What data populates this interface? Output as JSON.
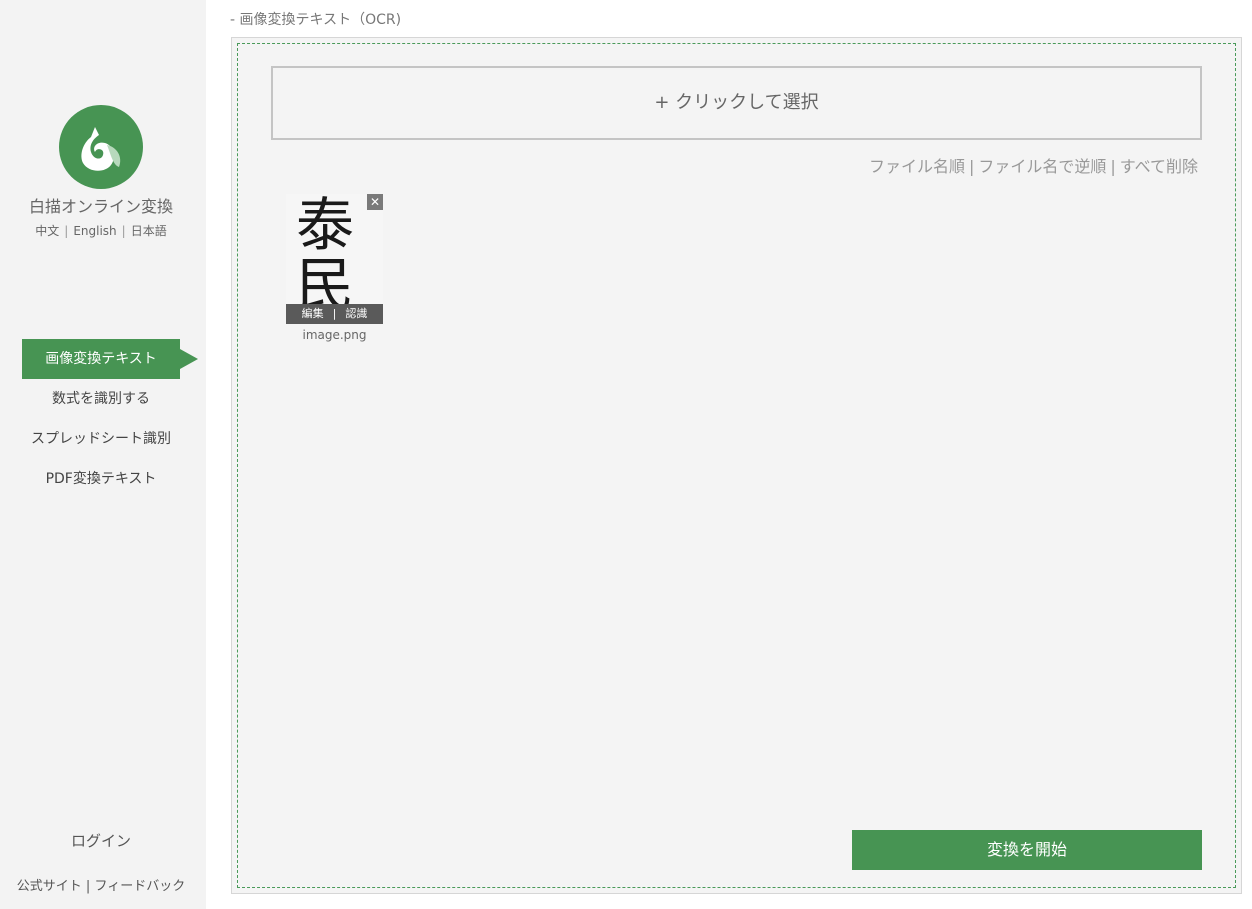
{
  "sidebar": {
    "app_name": "白描オンライン変換",
    "languages": [
      "中文",
      "English",
      "日本語"
    ],
    "nav": [
      {
        "label": "画像変換テキスト",
        "active": true
      },
      {
        "label": "数式を識別する",
        "active": false
      },
      {
        "label": "スプレッドシート識別",
        "active": false
      },
      {
        "label": "PDF変換テキスト",
        "active": false
      }
    ],
    "login_label": "ログイン",
    "footer": {
      "official_site": "公式サイト",
      "feedback": "フィードバック"
    }
  },
  "main": {
    "page_title": "- 画像変換テキスト（OCR)",
    "select_label": "+ クリックして選択",
    "sort": {
      "by_name": "ファイル名順",
      "by_name_reverse": "ファイル名で逆順",
      "delete_all": "すべて削除"
    },
    "file": {
      "name": "image.png",
      "preview_chars": [
        "泰",
        "民"
      ],
      "edit_label": "編集",
      "recognize_label": "認識",
      "close_glyph": "✕"
    },
    "start_label": "変換を開始"
  },
  "colors": {
    "accent": "#479453",
    "sidebar_bg": "#f3f3f3",
    "work_bg": "#f4f4f4"
  },
  "icons": {
    "logo": "squirrel-logo-icon",
    "close": "close-icon"
  }
}
